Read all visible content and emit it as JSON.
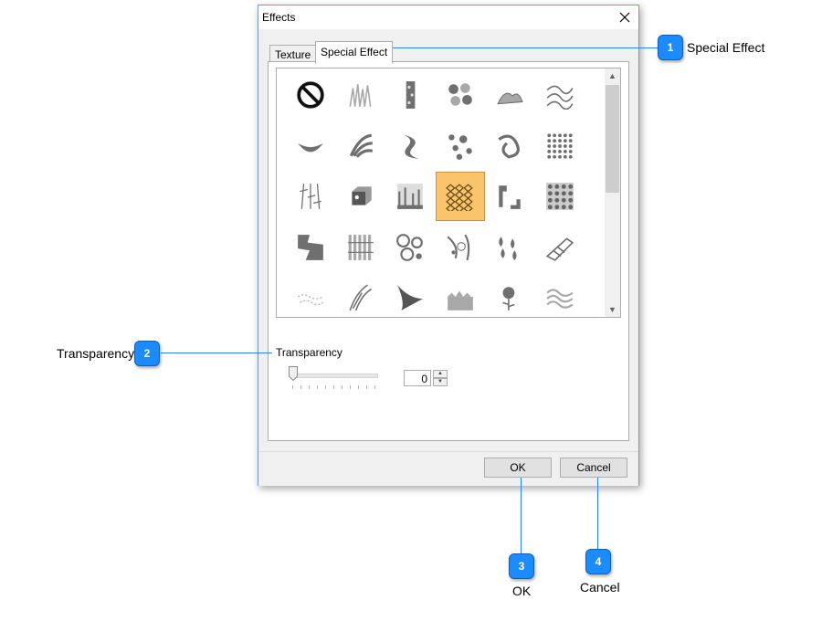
{
  "dialog": {
    "title": "Effects",
    "tabs": [
      {
        "label": "Texture",
        "active": false
      },
      {
        "label": "Special Effect",
        "active": true
      }
    ],
    "effects": [
      "none-icon",
      "grass-icon",
      "stones-strip-icon",
      "circles-icon",
      "coral-icon",
      "waves-icon",
      "leaf-icon",
      "feather-icon",
      "swirl-icon",
      "splatter-icon",
      "knot-icon",
      "dots-icon",
      "vines-icon",
      "cube-icon",
      "trees-icon",
      "diamond-pattern-icon",
      "corner-icon",
      "floral-pattern-icon",
      "map-icon",
      "bars-icon",
      "rings-icon",
      "bubbles-icon",
      "leaves-icon",
      "bird-icon",
      "scribble-icon",
      "quills-icon",
      "fan-icon",
      "skyline-icon",
      "flower-icon",
      "smoke-icon"
    ],
    "selected_effect_index": 15,
    "transparency_label": "Transparency",
    "transparency_value": "0",
    "ok_label": "OK",
    "cancel_label": "Cancel"
  },
  "callouts": [
    {
      "number": "1",
      "label": "Special Effect"
    },
    {
      "number": "2",
      "label": "Transparency"
    },
    {
      "number": "3",
      "label": "OK"
    },
    {
      "number": "4",
      "label": "Cancel"
    }
  ],
  "colors": {
    "badge": "#1a8cff",
    "callout_line": "#2a7fff",
    "selected_effect": "#f9c46b"
  }
}
